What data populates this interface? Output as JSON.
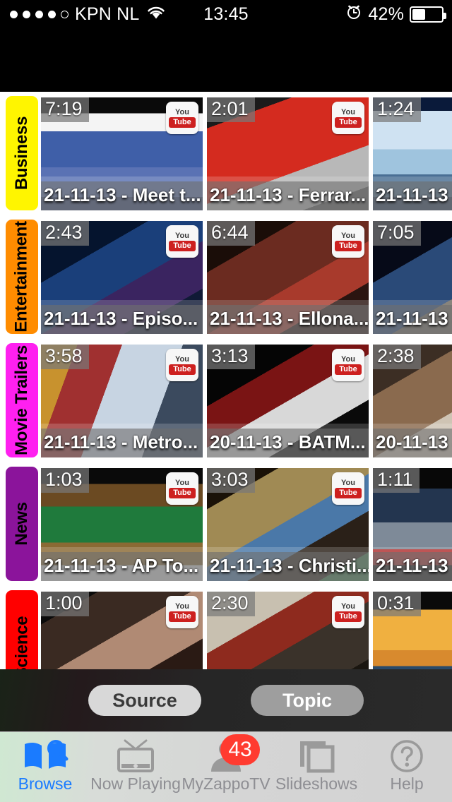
{
  "status_bar": {
    "signal_dots": [
      true,
      true,
      true,
      true,
      false
    ],
    "carrier": "KPN NL",
    "wifi_icon": "wifi-icon",
    "time": "13:45",
    "alarm_icon": "alarm-clock-icon",
    "battery_percent": "42%",
    "battery_level": 42
  },
  "categories": [
    {
      "name": "Business",
      "color": "#FFF500",
      "text_color": "#000000",
      "videos": [
        {
          "duration": "7:19",
          "title": "21-11-13 - Meet t...",
          "source_icon": "youtube-icon"
        },
        {
          "duration": "2:01",
          "title": "21-11-13 - Ferrar...",
          "source_icon": "youtube-icon"
        },
        {
          "duration": "1:24",
          "title": "21-11-13 -",
          "source_icon": "youtube-icon"
        }
      ]
    },
    {
      "name": "Entertainment",
      "color": "#FF8C00",
      "text_color": "#000000",
      "videos": [
        {
          "duration": "2:43",
          "title": "21-11-13 - Episo...",
          "source_icon": "youtube-icon"
        },
        {
          "duration": "6:44",
          "title": "21-11-13 - Ellona...",
          "source_icon": "youtube-icon"
        },
        {
          "duration": "7:05",
          "title": "21-11-13 -",
          "source_icon": "youtube-icon"
        }
      ]
    },
    {
      "name": "Movie Trailers",
      "color": "#FF20F0",
      "text_color": "#000000",
      "videos": [
        {
          "duration": "3:58",
          "title": "21-11-13 - Metro...",
          "source_icon": "youtube-icon"
        },
        {
          "duration": "3:13",
          "title": "20-11-13 - BATM...",
          "source_icon": "youtube-icon"
        },
        {
          "duration": "2:38",
          "title": "20-11-13 -",
          "source_icon": "youtube-icon"
        }
      ]
    },
    {
      "name": "News",
      "color": "#8B149B",
      "text_color": "#000000",
      "videos": [
        {
          "duration": "1:03",
          "title": "21-11-13 - AP To...",
          "source_icon": "youtube-icon"
        },
        {
          "duration": "3:03",
          "title": "21-11-13 - Christi...",
          "source_icon": "youtube-icon"
        },
        {
          "duration": "1:11",
          "title": "21-11-13 -",
          "source_icon": "youtube-icon"
        }
      ]
    },
    {
      "name": "Science",
      "color": "#FF0000",
      "text_color": "#000000",
      "videos": [
        {
          "duration": "1:00",
          "title": "",
          "source_icon": "youtube-icon"
        },
        {
          "duration": "2:30",
          "title": "",
          "source_icon": "youtube-icon"
        },
        {
          "duration": "0:31",
          "title": "",
          "source_icon": "youtube-icon"
        }
      ]
    }
  ],
  "segmented_control": {
    "options": [
      {
        "label": "Source",
        "selected": true
      },
      {
        "label": "Topic",
        "selected": false
      }
    ]
  },
  "tab_bar": {
    "active_color": "#1a7bff",
    "inactive_color": "#8e8e93",
    "tabs": [
      {
        "label": "Browse",
        "icon": "book-search-icon",
        "active": true,
        "badge": null
      },
      {
        "label": "Now Playing",
        "icon": "television-icon",
        "active": false,
        "badge": null
      },
      {
        "label": "MyZappoTV",
        "icon": "person-icon",
        "active": false,
        "badge": "43"
      },
      {
        "label": "Slideshows",
        "icon": "photos-stack-icon",
        "active": false,
        "badge": null
      },
      {
        "label": "Help",
        "icon": "question-circle-icon",
        "active": false,
        "badge": null
      }
    ]
  }
}
